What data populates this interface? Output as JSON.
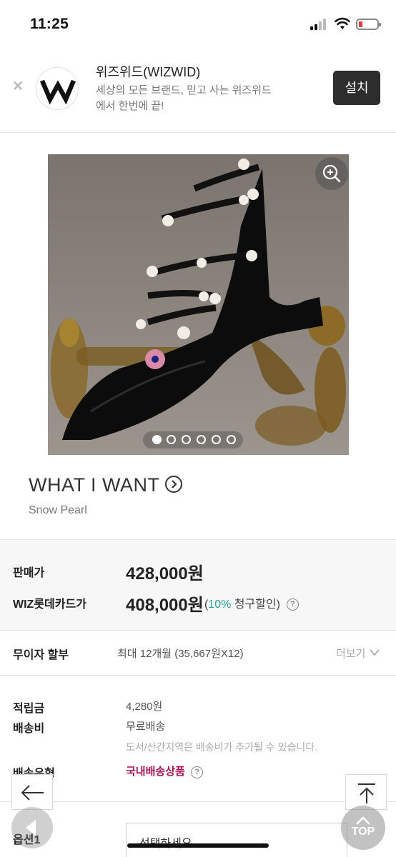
{
  "status_bar": {
    "time": "11:25",
    "icons": [
      "signal-icon",
      "wifi-icon",
      "battery-low-icon"
    ],
    "battery_color": "#e53935"
  },
  "app_banner": {
    "logo_letter": "W",
    "app_name": "위즈위드(WIZWID)",
    "description": "세상의 모든 브랜드, 믿고 사는 위즈위드에서 한번에 끝!",
    "install_label": "설치",
    "close_icon": "close-icon"
  },
  "product": {
    "image_alt_icon": "product-photo",
    "zoom_icon": "zoom-in-icon",
    "carousel": {
      "total": 6,
      "active": 1
    },
    "brand": "WHAT I WANT",
    "brand_link_icon": "chevron-right-circle-icon",
    "name": "Snow Pearl"
  },
  "price": {
    "sale_label": "판매가",
    "sale_value": "428,000원",
    "card_label": "WIZ롯데카드가",
    "card_value": "408,000원",
    "card_note_open": "(",
    "card_discount": "10%",
    "card_note_rest": " 청구할인)",
    "help_icon": "help-circle-icon"
  },
  "installment": {
    "label": "무이자 할부",
    "value": "최대 12개월 (35,667원X12)",
    "more": "더보기"
  },
  "info": {
    "points_label": "적립금",
    "points_value": "4,280원",
    "shipping_label": "배송비",
    "shipping_value": "무료배송",
    "shipping_note": "도서/산간지역은 배송비가 추가될 수 있습니다.",
    "ship_type_label": "배송유형",
    "ship_type_value": "국내배송상품",
    "ship_type_color": "#a3155a"
  },
  "options": {
    "label": "옵션1",
    "placeholder": "선택하세요"
  },
  "nav": {
    "back_icon": "arrow-left-icon",
    "top_icon": "arrow-up-to-top-icon",
    "top_label": "TOP"
  }
}
